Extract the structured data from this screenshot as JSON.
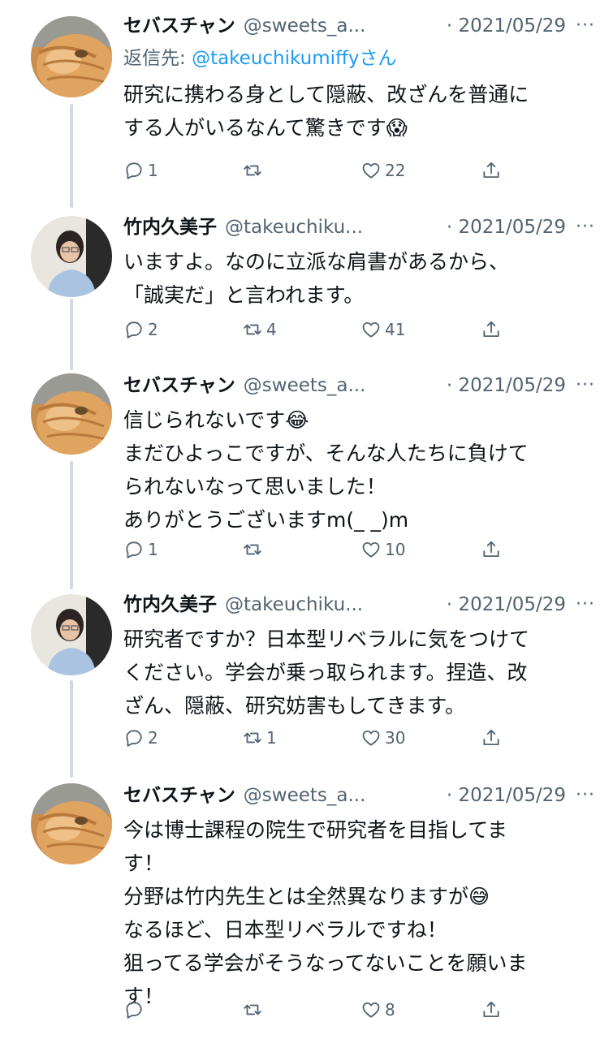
{
  "tweets": [
    {
      "name": "セバスチャン",
      "handle": "@sweets_a...",
      "date": "· 2021/05/29",
      "more": "···",
      "reply_prefix": "返信先: ",
      "reply_mention": "@takeuchikumiffy",
      "reply_suffix": "さん",
      "body": "研究に携わる身として隠蔽、改ざんを普通に\nする人がいるなんて驚きです😱",
      "replies": "1",
      "retweets": "",
      "likes": "22",
      "avatar": "cat"
    },
    {
      "name": "竹内久美子",
      "handle": "@takeuchiku...",
      "date": "· 2021/05/29",
      "more": "···",
      "body": "いますよ。なのに立派な肩書があるから、\n「誠実だ」と言われます。",
      "replies": "2",
      "retweets": "4",
      "likes": "41",
      "avatar": "woman"
    },
    {
      "name": "セバスチャン",
      "handle": "@sweets_a...",
      "date": "· 2021/05/29",
      "more": "···",
      "body": "信じられないです😂\nまだひよっこですが、そんな人たちに負けて\nられないなって思いました！\nありがとうございますm(_ _)m",
      "replies": "1",
      "retweets": "",
      "likes": "10",
      "avatar": "cat"
    },
    {
      "name": "竹内久美子",
      "handle": "@takeuchiku...",
      "date": "· 2021/05/29",
      "more": "···",
      "body": "研究者ですか？日本型リベラルに気をつけて\nください。学会が乗っ取られます。捏造、改\nざん、隠蔽、研究妨害もしてきます。",
      "replies": "2",
      "retweets": "1",
      "likes": "30",
      "avatar": "woman"
    },
    {
      "name": "セバスチャン",
      "handle": "@sweets_a...",
      "date": "· 2021/05/29",
      "more": "···",
      "body": "今は博士課程の院生で研究者を目指してま\nす！\n分野は竹内先生とは全然異なりますが😅\nなるほど、日本型リベラルですね！\n狙ってる学会がそうなってないことを願いま\nす！",
      "replies": "",
      "retweets": "",
      "likes": "8",
      "avatar": "cat"
    }
  ],
  "icons": {
    "reply": "reply-icon",
    "retweet": "retweet-icon",
    "like": "heart-icon",
    "share": "share-icon"
  },
  "colors": {
    "text": "#0f1419",
    "secondary": "#536471",
    "link": "#1d9bf0",
    "thread": "#cfd9de"
  }
}
